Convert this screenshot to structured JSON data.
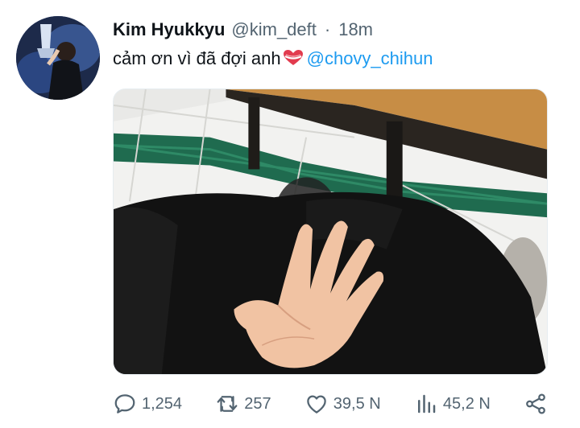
{
  "tweet": {
    "author_name": "Kim Hyukkyu",
    "author_handle": "@kim_deft",
    "separator": "·",
    "time": "18m",
    "text": "cảm ơn vì đã đợi anh",
    "mention": "@chovy_chihun"
  },
  "actions": {
    "replies": "1,254",
    "retweets": "257",
    "likes": "39,5 N",
    "views": "45,2 N"
  },
  "icons": {
    "reply": "reply-icon",
    "retweet": "retweet-icon",
    "like": "like-icon",
    "views": "views-icon",
    "share": "share-icon",
    "emoji": "heart-with-ribbon-icon"
  },
  "colors": {
    "text": "#0f1419",
    "secondary": "#536471",
    "link": "#1d9bf0"
  }
}
